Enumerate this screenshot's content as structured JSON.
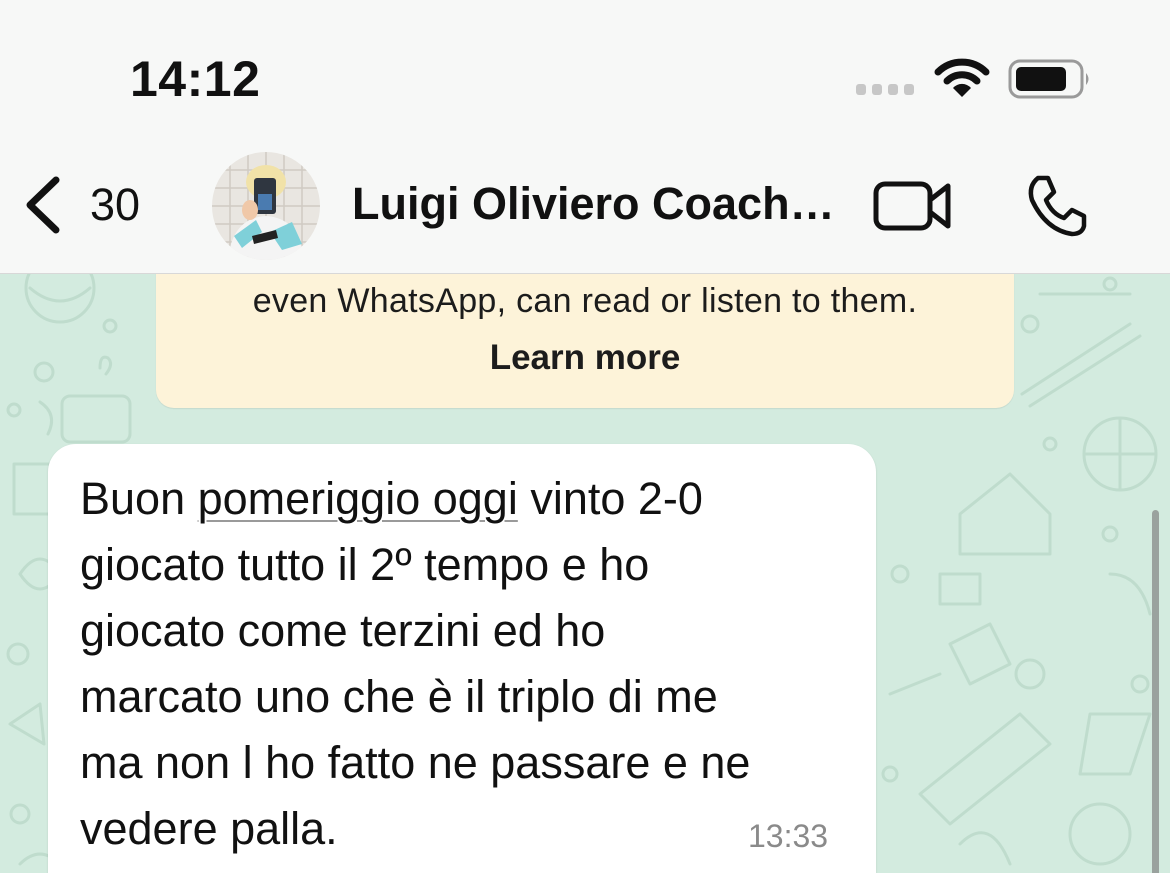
{
  "status_bar": {
    "time": "14:12",
    "wifi_icon": "wifi-icon",
    "battery_icon": "battery-icon"
  },
  "header": {
    "back_icon": "chevron-left-icon",
    "back_count": "30",
    "contact_name": "Luigi Oliviero Coach…",
    "video_icon": "video-camera-icon",
    "call_icon": "phone-icon"
  },
  "encryption_notice": {
    "text": "even WhatsApp, can read or listen to them.",
    "link": "Learn more"
  },
  "message": {
    "lines": {
      "l1_a": "Buon ",
      "l1_b": "pomeriggio oggi",
      "l1_c": " vinto 2-0",
      "l2": "giocato tutto il 2º tempo e ho",
      "l3": "giocato come terzini ed ho",
      "l4": "marcato uno che è il triplo di me",
      "l5": "ma non l ho fatto ne passare e ne",
      "l6": "vedere palla."
    },
    "time": "13:33"
  },
  "colors": {
    "chat_background": "#d3ebdf",
    "notice_background": "#fdf3d9",
    "bubble_background": "#ffffff",
    "header_background": "#f7f8f7"
  }
}
